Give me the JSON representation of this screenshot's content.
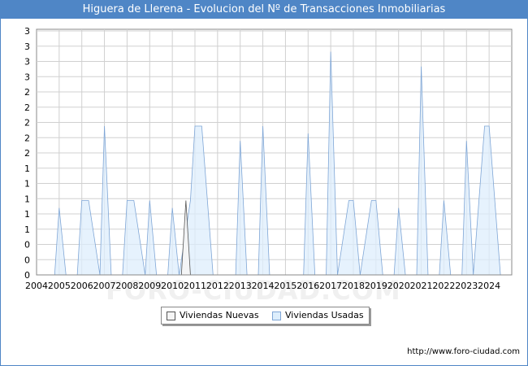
{
  "title": "Higuera de Llerena - Evolucion del Nº de Transacciones Inmobiliarias",
  "watermark": "FORO-CIUDAD.COM",
  "footer": "http://www.foro-ciudad.com",
  "colors": {
    "title_bg": "#4f86c6",
    "nuevas_fill": "#f5f5f5",
    "nuevas_stroke": "#555555",
    "usadas_fill": "#ddeefc",
    "usadas_stroke": "#7fa6d6"
  },
  "chart_data": {
    "type": "area",
    "title": "Higuera de Llerena - Evolucion del Nº de Transacciones Inmobiliarias",
    "x_ticks": [
      "2004",
      "2005",
      "2006",
      "2007",
      "2008",
      "2009",
      "2010",
      "2011",
      "2012",
      "2013",
      "2014",
      "2015",
      "2016",
      "2017",
      "2018",
      "2019",
      "2020",
      "2021",
      "2022",
      "2023",
      "2024"
    ],
    "y_tick_labels": [
      "0",
      "0",
      "0",
      "1",
      "1",
      "1",
      "1",
      "1",
      "2",
      "2",
      "2",
      "2",
      "2",
      "3",
      "3",
      "3",
      "3"
    ],
    "ylim": [
      0,
      3.3
    ],
    "grid": true,
    "legend_position": "bottom",
    "series": [
      {
        "name": "Viviendas Nuevas",
        "x": [
          2010.4,
          2010.6,
          2010.8,
          2011.0
        ],
        "values": [
          0,
          1,
          0,
          0
        ]
      },
      {
        "name": "Viviendas Usadas",
        "x": [
          2004.0,
          2004.8,
          2005.0,
          2005.3,
          2005.8,
          2006.0,
          2006.3,
          2006.8,
          2007.0,
          2007.3,
          2007.8,
          2008.0,
          2008.3,
          2008.8,
          2009.0,
          2009.3,
          2009.8,
          2010.0,
          2010.3,
          2010.8,
          2011.0,
          2011.3,
          2011.8,
          2012.0,
          2012.3,
          2012.8,
          2013.0,
          2013.3,
          2013.8,
          2014.0,
          2014.3,
          2014.8,
          2015.0,
          2015.3,
          2015.8,
          2016.0,
          2016.3,
          2016.8,
          2017.0,
          2017.3,
          2017.8,
          2018.0,
          2018.3,
          2018.8,
          2019.0,
          2019.3,
          2019.8,
          2020.0,
          2020.3,
          2020.8,
          2021.0,
          2021.3,
          2021.8,
          2022.0,
          2022.3,
          2022.8,
          2023.0,
          2023.3,
          2023.8,
          2024.0,
          2024.5
        ],
        "values": [
          0,
          0,
          0.9,
          0,
          0,
          1.0,
          1.0,
          0,
          2.0,
          0,
          0,
          1.0,
          1.0,
          0,
          1.0,
          0,
          0,
          0.9,
          0,
          1.0,
          2.0,
          2.0,
          0,
          0,
          0,
          0,
          1.8,
          0,
          0,
          2.0,
          0,
          0,
          0,
          0,
          0,
          1.9,
          0,
          0,
          3.0,
          0,
          1.0,
          1.0,
          0,
          1.0,
          1.0,
          0,
          0,
          0.9,
          0,
          0,
          2.8,
          0,
          0,
          1.0,
          0,
          0,
          1.8,
          0,
          2.0,
          2.0,
          0
        ]
      }
    ]
  }
}
